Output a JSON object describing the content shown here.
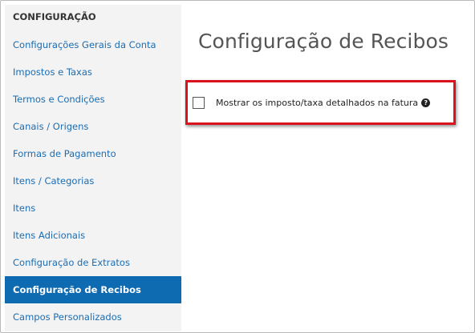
{
  "sidebar": {
    "header": "CONFIGURAÇÃO",
    "items": [
      {
        "label": "Configurações Gerais da Conta"
      },
      {
        "label": "Impostos e Taxas"
      },
      {
        "label": "Termos e Condições"
      },
      {
        "label": "Canais / Origens"
      },
      {
        "label": "Formas de Pagamento"
      },
      {
        "label": "Itens / Categorias"
      },
      {
        "label": "Itens"
      },
      {
        "label": "Itens Adicionais"
      },
      {
        "label": "Configuração de Extratos"
      },
      {
        "label": "Configuração de Recibos",
        "active": true
      },
      {
        "label": "Campos Personalizados"
      }
    ]
  },
  "main": {
    "title": "Configuração de Recibos",
    "option": {
      "label": "Mostrar os imposto/taxa detalhados na fatura",
      "checked": false,
      "help_icon": "question-circle-icon",
      "help_glyph": "?"
    }
  },
  "colors": {
    "active_background": "#0e6ab1",
    "link": "#1a6db4",
    "highlight_border": "#d9121b",
    "sidebar_background": "#f3f3f3"
  }
}
